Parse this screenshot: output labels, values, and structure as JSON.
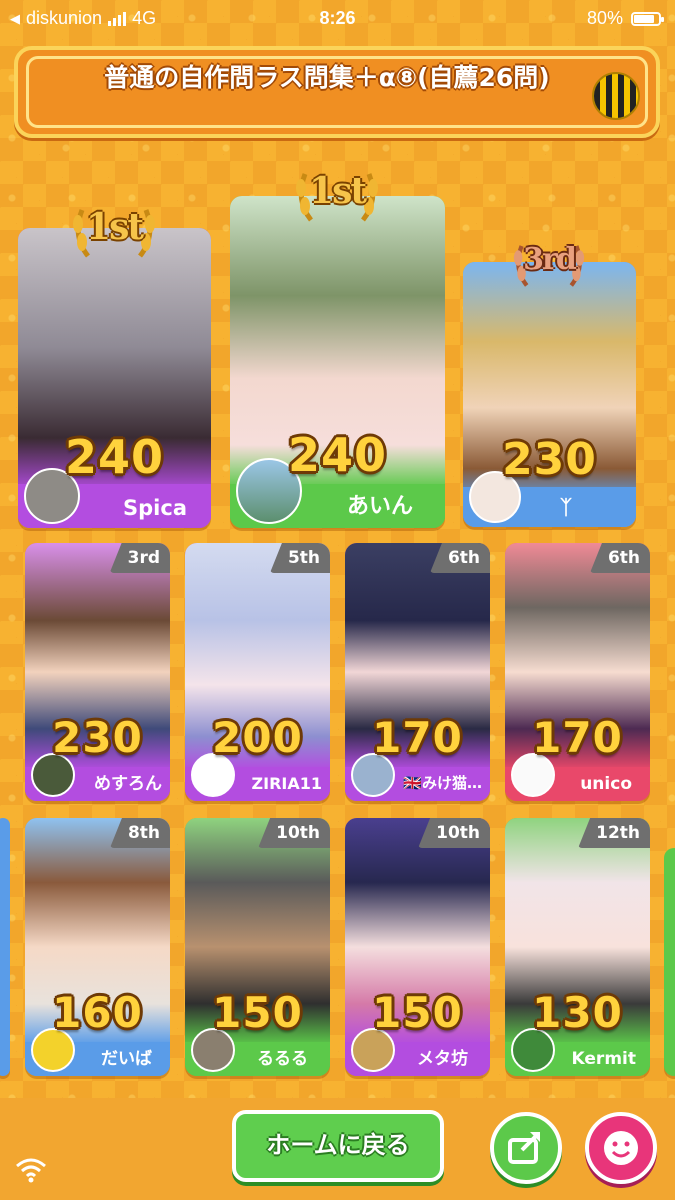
{
  "status_bar": {
    "carrier": "diskunion",
    "network": "4G",
    "time": "8:26",
    "battery": "80%"
  },
  "banner": {
    "title": "普通の自作問ラス問集＋α⑧(自薦26問)"
  },
  "top3": [
    {
      "rank_label": "1st",
      "score": "240",
      "name": "Spica",
      "color": "#b34de0"
    },
    {
      "rank_label": "1st",
      "score": "240",
      "name": "あいん",
      "color": "#5cc94a"
    },
    {
      "rank_label": "3rd",
      "score": "230",
      "name": "ᛉ",
      "color": "#5a9ce8"
    }
  ],
  "row2": [
    {
      "rank_label": "3rd",
      "score": "230",
      "name": "めすろん",
      "color": "#b34de0"
    },
    {
      "rank_label": "5th",
      "score": "200",
      "name": "ZIRIA11",
      "color": "#b34de0"
    },
    {
      "rank_label": "6th",
      "score": "170",
      "name": "🇬🇧みけ猫…",
      "color": "#b34de0"
    },
    {
      "rank_label": "6th",
      "score": "170",
      "name": "unico",
      "color": "#e9486a"
    }
  ],
  "row3": [
    {
      "rank_label": "8th",
      "score": "160",
      "name": "だいば",
      "color": "#5a9ce8"
    },
    {
      "rank_label": "10th",
      "score": "150",
      "name": "るるる",
      "color": "#5cc94a"
    },
    {
      "rank_label": "10th",
      "score": "150",
      "name": "メタ坊",
      "color": "#b34de0"
    },
    {
      "rank_label": "12th",
      "score": "130",
      "name": "Kermit",
      "color": "#5cc94a"
    }
  ],
  "footer": {
    "home_label": "ホームに戻る"
  }
}
